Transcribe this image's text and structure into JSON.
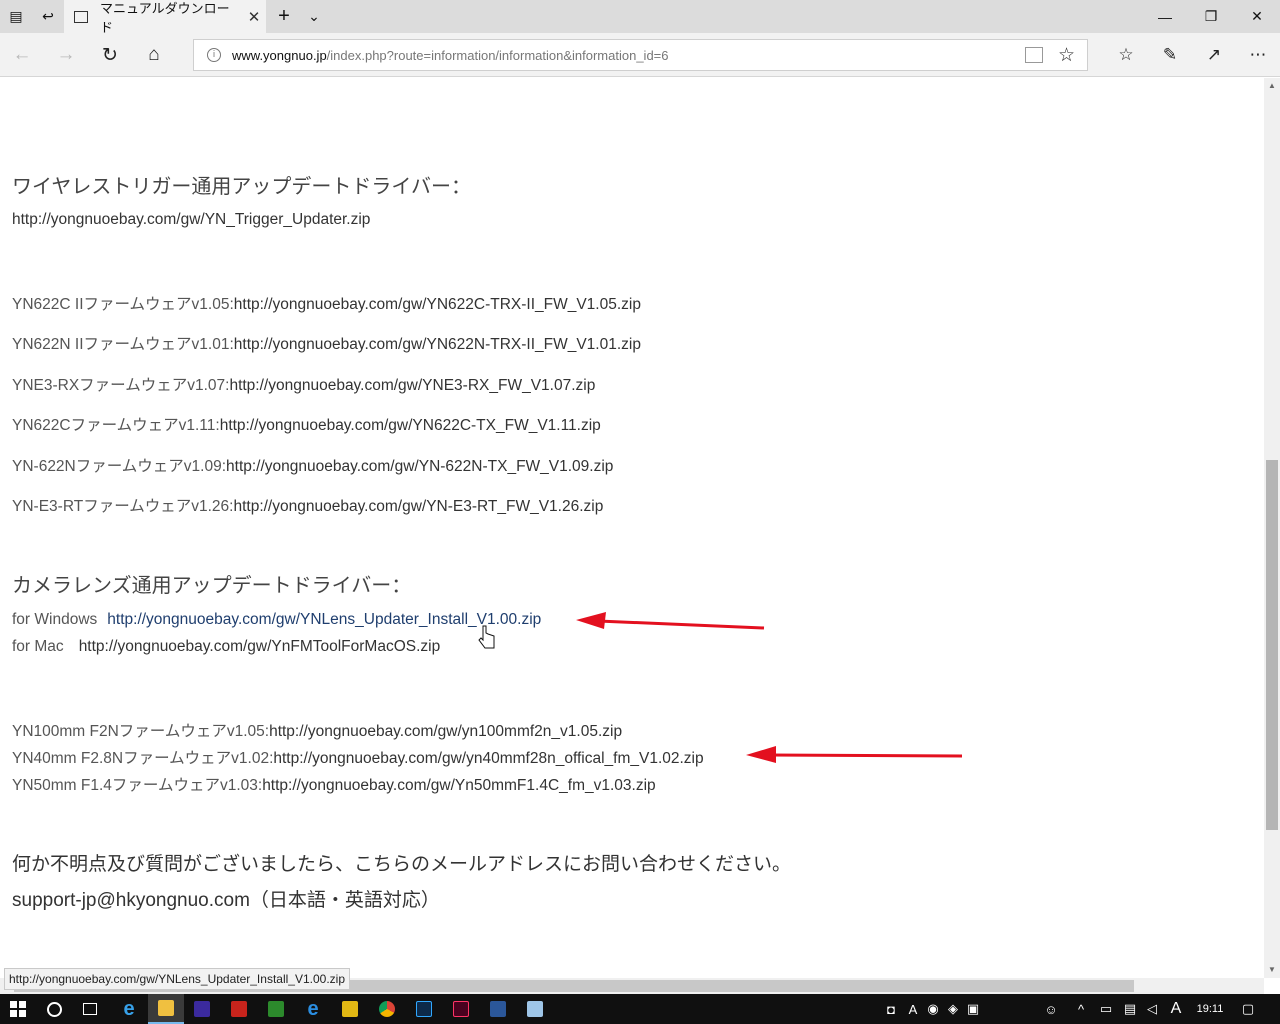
{
  "browser": {
    "tab_title": "マニュアルダウンロード",
    "url_host": "www.yongnuo.jp",
    "url_path": "/index.php?route=information/information&information_id=6",
    "status_bar_url": "http://yongnuoebay.com/gw/YNLens_Updater_Install_V1.00.zip"
  },
  "page": {
    "trigger_heading": "ワイヤレストリガー通用アップデートドライバー：",
    "trigger_link": "http://yongnuoebay.com/gw/YN_Trigger_Updater.zip",
    "firmware": [
      {
        "label": "YN622C IIファームウェアv1.05:",
        "url": "http://yongnuoebay.com/gw/YN622C-TRX-II_FW_V1.05.zip"
      },
      {
        "label": "YN622N IIファームウェアv1.01:",
        "url": "http://yongnuoebay.com/gw/YN622N-TRX-II_FW_V1.01.zip"
      },
      {
        "label": "YNE3-RXファームウェアv1.07:",
        "url": "http://yongnuoebay.com/gw/YNE3-RX_FW_V1.07.zip"
      },
      {
        "label": "YN622Cファームウェアv1.11:",
        "url": "http://yongnuoebay.com/gw/YN622C-TX_FW_V1.11.zip"
      },
      {
        "label": "YN-622Nファームウェアv1.09:",
        "url": "http://yongnuoebay.com/gw/YN-622N-TX_FW_V1.09.zip"
      },
      {
        "label": "YN-E3-RTファームウェアv1.26:",
        "url": "http://yongnuoebay.com/gw/YN-E3-RT_FW_V1.26.zip"
      }
    ],
    "lens_heading": "カメラレンズ通用アップデートドライバー：",
    "lens_windows_label": "for Windows",
    "lens_windows_url": "http://yongnuoebay.com/gw/YNLens_Updater_Install_V1.00.zip",
    "lens_mac_label": "for Mac",
    "lens_mac_url": "http://yongnuoebay.com/gw/YnFMToolForMacOS.zip",
    "lens_firmware": [
      {
        "label": "YN100mm F2Nファームウェアv1.05:",
        "url": "http://yongnuoebay.com/gw/yn100mmf2n_v1.05.zip"
      },
      {
        "label": "YN40mm F2.8Nファームウェアv1.02:",
        "url": "http://yongnuoebay.com/gw/yn40mmf28n_offical_fm_V1.02.zip"
      },
      {
        "label": "YN50mm F1.4ファームウェアv1.03:",
        "url": "http://yongnuoebay.com/gw/Yn50mmF1.4C_fm_v1.03.zip"
      }
    ],
    "contact_text": "何か不明点及び質問がございましたら、こちらのメールアドレスにお問い合わせください。",
    "contact_email": "support-jp@hkyongnuo.com（日本語・英語対応）"
  },
  "annotation_color": "#e3101f",
  "taskbar": {
    "clock": "19:11",
    "ime": "A"
  }
}
